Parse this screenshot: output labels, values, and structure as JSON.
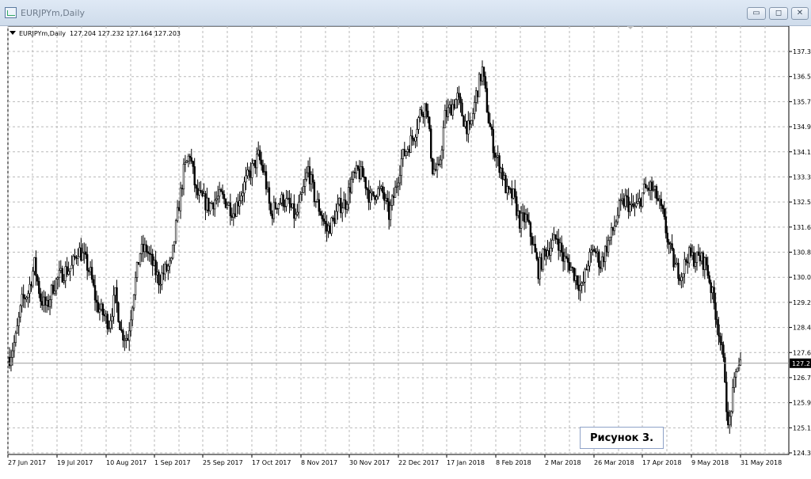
{
  "window": {
    "title": "EURJPYm,Daily",
    "buttons": {
      "minimize": "▭",
      "maximize": "◻",
      "close": "✕"
    }
  },
  "chart_header": {
    "symbol": "EURJPYm,Daily",
    "ohlc": "127.204 127.232 127.164 127.203"
  },
  "caption": "Рисунок 3.",
  "chart_data": {
    "type": "candlestick",
    "symbol": "EURJPYm",
    "timeframe": "Daily",
    "x_labels": [
      "27 Jun 2017",
      "19 Jul 2017",
      "10 Aug 2017",
      "1 Sep 2017",
      "25 Sep 2017",
      "17 Oct 2017",
      "8 Nov 2017",
      "30 Nov 2017",
      "22 Dec 2017",
      "17 Jan 2018",
      "8 Feb 2018",
      "2 Mar 2018",
      "26 Mar 2018",
      "17 Apr 2018",
      "9 May 2018",
      "31 May 2018"
    ],
    "y_labels": [
      "137.3",
      "136.5",
      "135.7",
      "134.9",
      "134.1",
      "133.3",
      "132.5",
      "131.6",
      "130.8",
      "130.0",
      "129.2",
      "128.4",
      "127.6",
      "126.7",
      "125.9",
      "125.1",
      "124.3"
    ],
    "current_price_label": "127.2",
    "current_price": 127.203,
    "ylim": [
      124.3,
      137.3
    ],
    "grid": true,
    "price_path": [
      [
        0,
        127.4
      ],
      [
        4,
        128.0
      ],
      [
        8,
        129.2
      ],
      [
        12,
        129.5
      ],
      [
        16,
        130.4
      ],
      [
        20,
        129.3
      ],
      [
        24,
        129.0
      ],
      [
        28,
        129.7
      ],
      [
        32,
        130.0
      ],
      [
        36,
        130.2
      ],
      [
        40,
        130.3
      ],
      [
        44,
        130.9
      ],
      [
        48,
        130.6
      ],
      [
        52,
        130.1
      ],
      [
        56,
        129.1
      ],
      [
        60,
        128.8
      ],
      [
        64,
        128.5
      ],
      [
        68,
        129.4
      ],
      [
        72,
        128.2
      ],
      [
        76,
        128.0
      ],
      [
        80,
        129.6
      ],
      [
        84,
        130.8
      ],
      [
        88,
        130.9
      ],
      [
        92,
        130.4
      ],
      [
        96,
        129.9
      ],
      [
        100,
        130.2
      ],
      [
        104,
        130.4
      ],
      [
        108,
        132.0
      ],
      [
        112,
        133.4
      ],
      [
        116,
        134.0
      ],
      [
        120,
        132.7
      ],
      [
        124,
        132.5
      ],
      [
        128,
        132.3
      ],
      [
        132,
        132.5
      ],
      [
        136,
        132.6
      ],
      [
        140,
        132.4
      ],
      [
        144,
        132.1
      ],
      [
        148,
        132.6
      ],
      [
        152,
        133.1
      ],
      [
        156,
        133.5
      ],
      [
        160,
        133.9
      ],
      [
        164,
        133.3
      ],
      [
        168,
        132.0
      ],
      [
        172,
        132.4
      ],
      [
        176,
        132.5
      ],
      [
        180,
        132.3
      ],
      [
        184,
        131.9
      ],
      [
        188,
        132.6
      ],
      [
        192,
        133.5
      ],
      [
        196,
        132.6
      ],
      [
        200,
        132.1
      ],
      [
        204,
        131.5
      ],
      [
        208,
        131.8
      ],
      [
        212,
        132.3
      ],
      [
        216,
        132.4
      ],
      [
        220,
        133.1
      ],
      [
        224,
        133.4
      ],
      [
        228,
        133.2
      ],
      [
        232,
        132.5
      ],
      [
        236,
        132.8
      ],
      [
        240,
        132.7
      ],
      [
        244,
        132.0
      ],
      [
        248,
        132.8
      ],
      [
        252,
        133.8
      ],
      [
        256,
        134.2
      ],
      [
        260,
        134.6
      ],
      [
        264,
        135.3
      ],
      [
        268,
        135.6
      ],
      [
        272,
        133.5
      ],
      [
        276,
        133.4
      ],
      [
        280,
        135.2
      ],
      [
        284,
        135.5
      ],
      [
        288,
        135.8
      ],
      [
        292,
        135.1
      ],
      [
        296,
        134.7
      ],
      [
        300,
        135.9
      ],
      [
        304,
        136.7
      ],
      [
        308,
        135.1
      ],
      [
        312,
        134.0
      ],
      [
        316,
        133.5
      ],
      [
        320,
        132.7
      ],
      [
        324,
        132.6
      ],
      [
        328,
        131.8
      ],
      [
        332,
        131.9
      ],
      [
        336,
        131.2
      ],
      [
        340,
        130.2
      ],
      [
        344,
        130.8
      ],
      [
        348,
        131.0
      ],
      [
        352,
        131.3
      ],
      [
        356,
        130.6
      ],
      [
        360,
        130.4
      ],
      [
        364,
        130.0
      ],
      [
        368,
        129.6
      ],
      [
        372,
        130.5
      ],
      [
        376,
        130.9
      ],
      [
        380,
        130.4
      ],
      [
        384,
        131.0
      ],
      [
        388,
        131.5
      ],
      [
        392,
        132.2
      ],
      [
        396,
        132.5
      ],
      [
        400,
        132.2
      ],
      [
        404,
        132.3
      ],
      [
        408,
        132.8
      ],
      [
        412,
        132.9
      ],
      [
        416,
        132.6
      ],
      [
        420,
        132.0
      ],
      [
        424,
        131.0
      ],
      [
        428,
        130.3
      ],
      [
        432,
        130.1
      ],
      [
        436,
        130.7
      ],
      [
        440,
        130.6
      ],
      [
        444,
        130.6
      ],
      [
        448,
        130.4
      ],
      [
        452,
        129.4
      ],
      [
        456,
        128.3
      ],
      [
        460,
        126.8
      ],
      [
        462,
        125.0
      ],
      [
        464,
        125.8
      ],
      [
        468,
        127.2
      ],
      [
        470,
        127.2
      ]
    ]
  }
}
